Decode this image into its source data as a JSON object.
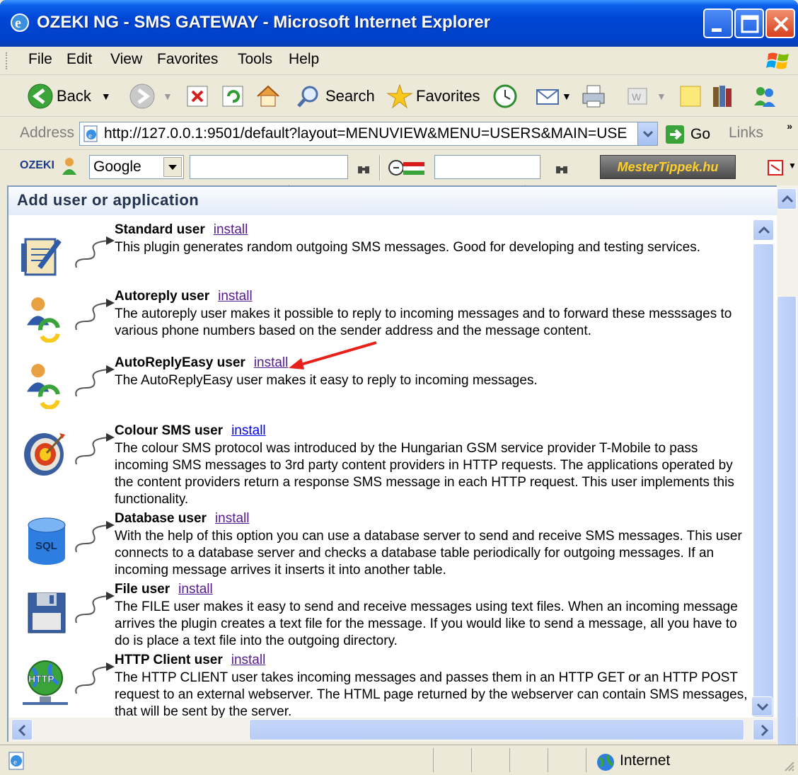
{
  "window": {
    "title": "OZEKI NG - SMS GATEWAY - Microsoft Internet Explorer"
  },
  "menu": [
    "File",
    "Edit",
    "View",
    "Favorites",
    "Tools",
    "Help"
  ],
  "toolbar": {
    "back": "Back",
    "search": "Search",
    "favorites": "Favorites"
  },
  "address": {
    "label": "Address",
    "url": "http://127.0.0.1:9501/default?layout=MENUVIEW&MENU=USERS&MAIN=USE",
    "go": "Go",
    "links": "Links"
  },
  "googlebar": {
    "logo": "OZEKI",
    "engine": "Google",
    "site": "MesterTippek.hu"
  },
  "page": {
    "heading": "Add user or application",
    "entries": [
      {
        "name": "Standard user",
        "link": "install",
        "desc": "This plugin generates random outgoing SMS messages. Good for developing and testing services.",
        "icon": "notepad-icon"
      },
      {
        "name": "Autoreply user",
        "link": "install",
        "desc": "The autoreply user makes it possible to reply to incoming messages and to forward these messsages to various phone numbers based on the sender address and the message content.",
        "icon": "person-refresh-icon"
      },
      {
        "name": "AutoReplyEasy user",
        "link": "install",
        "desc": "The AutoReplyEasy user makes it easy to reply to incoming messages.",
        "icon": "person-refresh-icon"
      },
      {
        "name": "Colour SMS user",
        "link": "install",
        "desc": "The colour SMS protocol was introduced by the Hungarian GSM service provider T-Mobile to pass incoming SMS messages to 3rd party content providers in HTTP requests. The applications operated by the content providers return a response SMS message in each HTTP request. This user implements this functionality.",
        "icon": "target-icon"
      },
      {
        "name": "Database user",
        "link": "install",
        "desc": "With the help of this option you can use a database server to send and receive SMS messages. This user connects to a database server and checks a database table periodically for outgoing messages. If an incoming message arrives it inserts it into another table.",
        "icon": "database-icon",
        "icon_text": "SQL"
      },
      {
        "name": "File user",
        "link": "install",
        "desc": "The FILE user makes it easy to send and receive messages using text files. When an incoming message arrives the plugin creates a text file for the message. If you would like to send a message, all you have to do is place a text file into the outgoing directory.",
        "icon": "floppy-icon"
      },
      {
        "name": "HTTP Client user",
        "link": "install",
        "desc": "The HTTP CLIENT user takes incoming messages and passes them in an HTTP GET or an HTTP POST request to an external webserver. The HTML page returned by the webserver can contain SMS messages, that will be sent by the server.",
        "icon": "http-globe-icon",
        "icon_text": "HTTP"
      }
    ]
  },
  "status": {
    "zone": "Internet"
  },
  "colors": {
    "title_blue": "#0046d5",
    "link_visited": "#551a8b",
    "link_blue": "#0000ee",
    "arrow_red": "#e8201a"
  }
}
